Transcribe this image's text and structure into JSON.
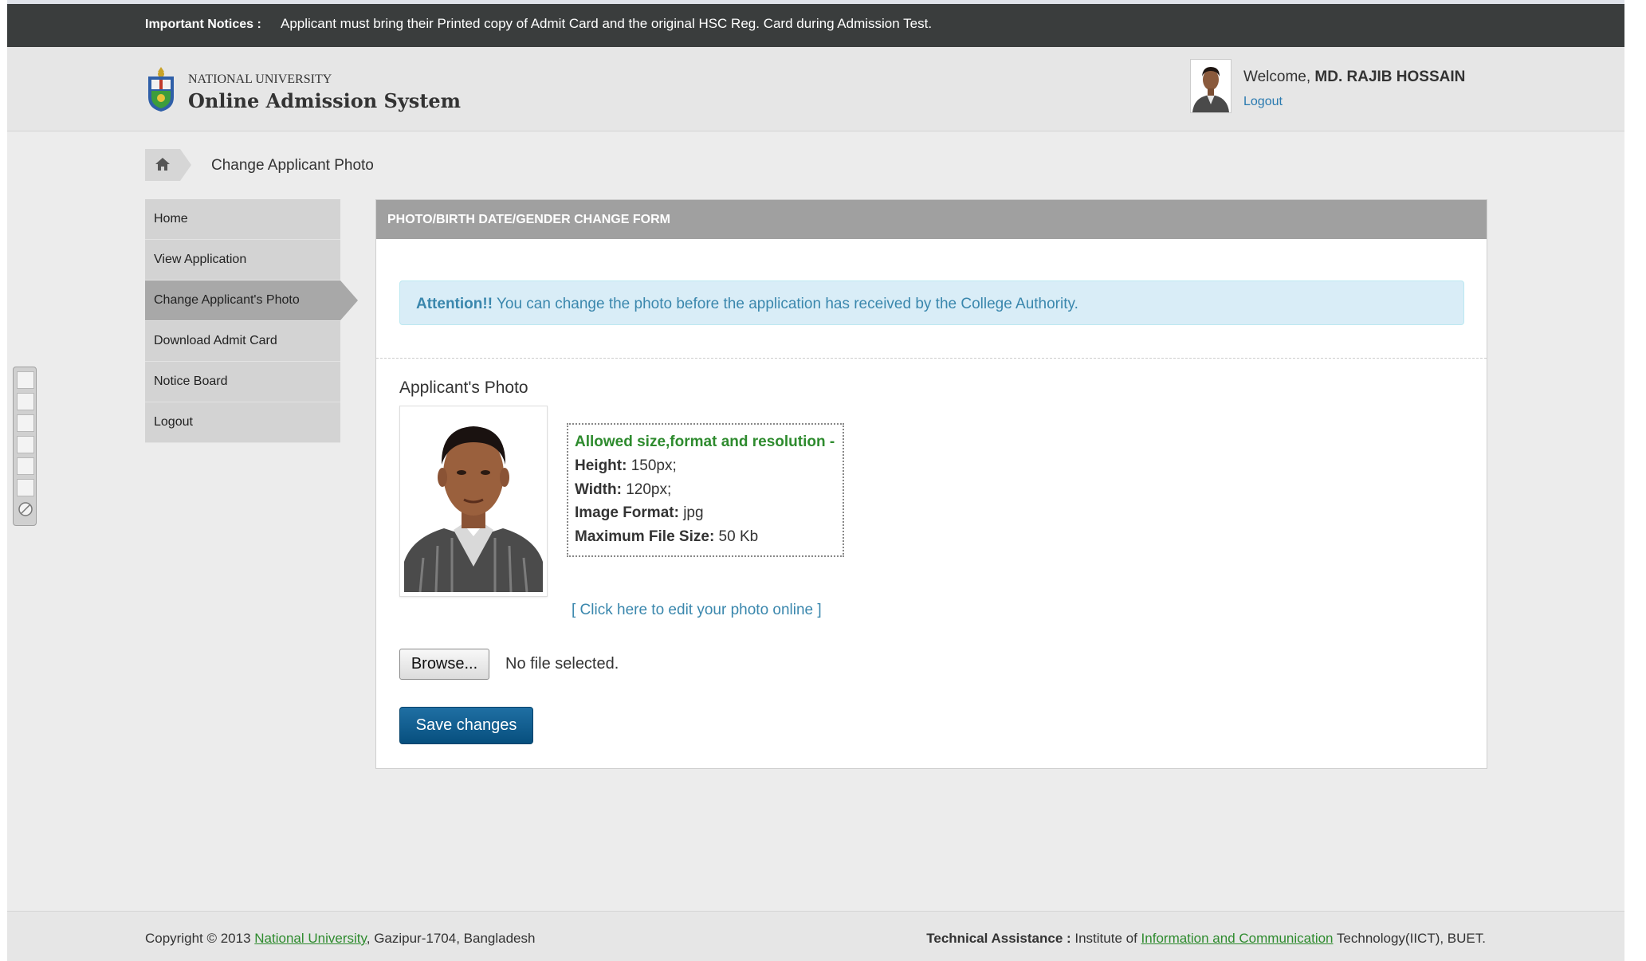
{
  "notice": {
    "label": "Important Notices :",
    "text": "Applicant must bring their Printed copy of Admit Card and the original HSC Reg. Card during Admission Test."
  },
  "brand": {
    "sub": "NATIONAL UNIVERSITY",
    "main": "Online Admission System"
  },
  "user": {
    "welcome_prefix": "Welcome,",
    "name": "MD. RAJIB HOSSAIN",
    "logout_label": "Logout"
  },
  "breadcrumb": {
    "current": "Change Applicant Photo"
  },
  "sidebar": {
    "items": [
      {
        "label": "Home"
      },
      {
        "label": "View Application"
      },
      {
        "label": "Change Applicant's Photo"
      },
      {
        "label": "Download Admit Card"
      },
      {
        "label": "Notice Board"
      },
      {
        "label": "Logout"
      }
    ],
    "active_index": 2
  },
  "panel": {
    "title": "PHOTO/BIRTH DATE/GENDER CHANGE FORM",
    "alert_strong": "Attention!!",
    "alert_text": " You can change the photo before the application has received by the College Authority.",
    "photo_label": "Applicant's Photo",
    "allowed": {
      "title": "Allowed size,format and resolution -",
      "height_label": "Height:",
      "height_value": " 150px;",
      "width_label": "Width:",
      "width_value": " 120px;",
      "format_label": "Image Format:",
      "format_value": " jpg",
      "filesize_label": "Maximum File Size:",
      "filesize_value": " 50 Kb"
    },
    "edit_link": "[ Click here to edit your photo online ]",
    "browse_label": "Browse...",
    "file_status": "No file selected.",
    "save_label": "Save changes"
  },
  "footer": {
    "copyright_prefix": "Copyright © 2013 ",
    "university_link": "National University",
    "address": ", Gazipur-1704, Bangladesh",
    "tech_label": "Technical Assistance :",
    "tech_prefix": " Institute of ",
    "ict_link": "Information and Communication",
    "tech_suffix": " Technology(IICT), BUET."
  },
  "colors": {
    "notice_bg": "#3a3d3d",
    "header_bg": "#e6e6e6",
    "panel_head_bg": "#a0a0a0",
    "alert_bg": "#d9edf7",
    "alert_text": "#3a87ad",
    "save_button": "#0a5a8e",
    "green_text": "#2e8b2e",
    "active_menu": "#a8a8a8"
  },
  "icons": {
    "home": "home-icon",
    "logo": "university-logo-icon"
  }
}
